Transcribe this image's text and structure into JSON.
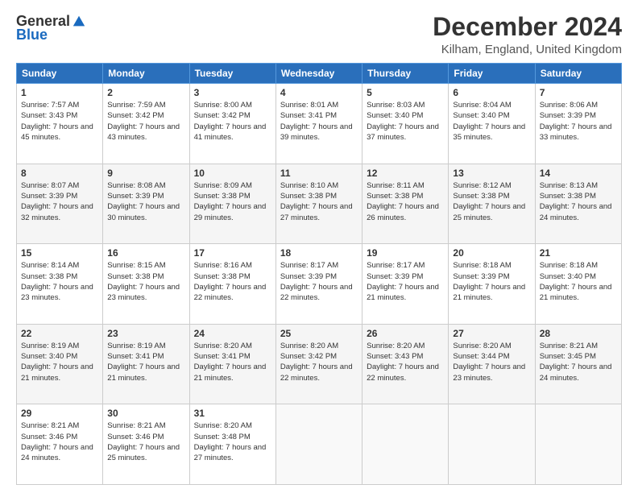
{
  "header": {
    "logo_general": "General",
    "logo_blue": "Blue",
    "title": "December 2024",
    "subtitle": "Kilham, England, United Kingdom"
  },
  "weekdays": [
    "Sunday",
    "Monday",
    "Tuesday",
    "Wednesday",
    "Thursday",
    "Friday",
    "Saturday"
  ],
  "weeks": [
    [
      {
        "day": "1",
        "sunrise": "Sunrise: 7:57 AM",
        "sunset": "Sunset: 3:43 PM",
        "daylight": "Daylight: 7 hours and 45 minutes."
      },
      {
        "day": "2",
        "sunrise": "Sunrise: 7:59 AM",
        "sunset": "Sunset: 3:42 PM",
        "daylight": "Daylight: 7 hours and 43 minutes."
      },
      {
        "day": "3",
        "sunrise": "Sunrise: 8:00 AM",
        "sunset": "Sunset: 3:42 PM",
        "daylight": "Daylight: 7 hours and 41 minutes."
      },
      {
        "day": "4",
        "sunrise": "Sunrise: 8:01 AM",
        "sunset": "Sunset: 3:41 PM",
        "daylight": "Daylight: 7 hours and 39 minutes."
      },
      {
        "day": "5",
        "sunrise": "Sunrise: 8:03 AM",
        "sunset": "Sunset: 3:40 PM",
        "daylight": "Daylight: 7 hours and 37 minutes."
      },
      {
        "day": "6",
        "sunrise": "Sunrise: 8:04 AM",
        "sunset": "Sunset: 3:40 PM",
        "daylight": "Daylight: 7 hours and 35 minutes."
      },
      {
        "day": "7",
        "sunrise": "Sunrise: 8:06 AM",
        "sunset": "Sunset: 3:39 PM",
        "daylight": "Daylight: 7 hours and 33 minutes."
      }
    ],
    [
      {
        "day": "8",
        "sunrise": "Sunrise: 8:07 AM",
        "sunset": "Sunset: 3:39 PM",
        "daylight": "Daylight: 7 hours and 32 minutes."
      },
      {
        "day": "9",
        "sunrise": "Sunrise: 8:08 AM",
        "sunset": "Sunset: 3:39 PM",
        "daylight": "Daylight: 7 hours and 30 minutes."
      },
      {
        "day": "10",
        "sunrise": "Sunrise: 8:09 AM",
        "sunset": "Sunset: 3:38 PM",
        "daylight": "Daylight: 7 hours and 29 minutes."
      },
      {
        "day": "11",
        "sunrise": "Sunrise: 8:10 AM",
        "sunset": "Sunset: 3:38 PM",
        "daylight": "Daylight: 7 hours and 27 minutes."
      },
      {
        "day": "12",
        "sunrise": "Sunrise: 8:11 AM",
        "sunset": "Sunset: 3:38 PM",
        "daylight": "Daylight: 7 hours and 26 minutes."
      },
      {
        "day": "13",
        "sunrise": "Sunrise: 8:12 AM",
        "sunset": "Sunset: 3:38 PM",
        "daylight": "Daylight: 7 hours and 25 minutes."
      },
      {
        "day": "14",
        "sunrise": "Sunrise: 8:13 AM",
        "sunset": "Sunset: 3:38 PM",
        "daylight": "Daylight: 7 hours and 24 minutes."
      }
    ],
    [
      {
        "day": "15",
        "sunrise": "Sunrise: 8:14 AM",
        "sunset": "Sunset: 3:38 PM",
        "daylight": "Daylight: 7 hours and 23 minutes."
      },
      {
        "day": "16",
        "sunrise": "Sunrise: 8:15 AM",
        "sunset": "Sunset: 3:38 PM",
        "daylight": "Daylight: 7 hours and 23 minutes."
      },
      {
        "day": "17",
        "sunrise": "Sunrise: 8:16 AM",
        "sunset": "Sunset: 3:38 PM",
        "daylight": "Daylight: 7 hours and 22 minutes."
      },
      {
        "day": "18",
        "sunrise": "Sunrise: 8:17 AM",
        "sunset": "Sunset: 3:39 PM",
        "daylight": "Daylight: 7 hours and 22 minutes."
      },
      {
        "day": "19",
        "sunrise": "Sunrise: 8:17 AM",
        "sunset": "Sunset: 3:39 PM",
        "daylight": "Daylight: 7 hours and 21 minutes."
      },
      {
        "day": "20",
        "sunrise": "Sunrise: 8:18 AM",
        "sunset": "Sunset: 3:39 PM",
        "daylight": "Daylight: 7 hours and 21 minutes."
      },
      {
        "day": "21",
        "sunrise": "Sunrise: 8:18 AM",
        "sunset": "Sunset: 3:40 PM",
        "daylight": "Daylight: 7 hours and 21 minutes."
      }
    ],
    [
      {
        "day": "22",
        "sunrise": "Sunrise: 8:19 AM",
        "sunset": "Sunset: 3:40 PM",
        "daylight": "Daylight: 7 hours and 21 minutes."
      },
      {
        "day": "23",
        "sunrise": "Sunrise: 8:19 AM",
        "sunset": "Sunset: 3:41 PM",
        "daylight": "Daylight: 7 hours and 21 minutes."
      },
      {
        "day": "24",
        "sunrise": "Sunrise: 8:20 AM",
        "sunset": "Sunset: 3:41 PM",
        "daylight": "Daylight: 7 hours and 21 minutes."
      },
      {
        "day": "25",
        "sunrise": "Sunrise: 8:20 AM",
        "sunset": "Sunset: 3:42 PM",
        "daylight": "Daylight: 7 hours and 22 minutes."
      },
      {
        "day": "26",
        "sunrise": "Sunrise: 8:20 AM",
        "sunset": "Sunset: 3:43 PM",
        "daylight": "Daylight: 7 hours and 22 minutes."
      },
      {
        "day": "27",
        "sunrise": "Sunrise: 8:20 AM",
        "sunset": "Sunset: 3:44 PM",
        "daylight": "Daylight: 7 hours and 23 minutes."
      },
      {
        "day": "28",
        "sunrise": "Sunrise: 8:21 AM",
        "sunset": "Sunset: 3:45 PM",
        "daylight": "Daylight: 7 hours and 24 minutes."
      }
    ],
    [
      {
        "day": "29",
        "sunrise": "Sunrise: 8:21 AM",
        "sunset": "Sunset: 3:46 PM",
        "daylight": "Daylight: 7 hours and 24 minutes."
      },
      {
        "day": "30",
        "sunrise": "Sunrise: 8:21 AM",
        "sunset": "Sunset: 3:46 PM",
        "daylight": "Daylight: 7 hours and 25 minutes."
      },
      {
        "day": "31",
        "sunrise": "Sunrise: 8:20 AM",
        "sunset": "Sunset: 3:48 PM",
        "daylight": "Daylight: 7 hours and 27 minutes."
      },
      null,
      null,
      null,
      null
    ]
  ]
}
